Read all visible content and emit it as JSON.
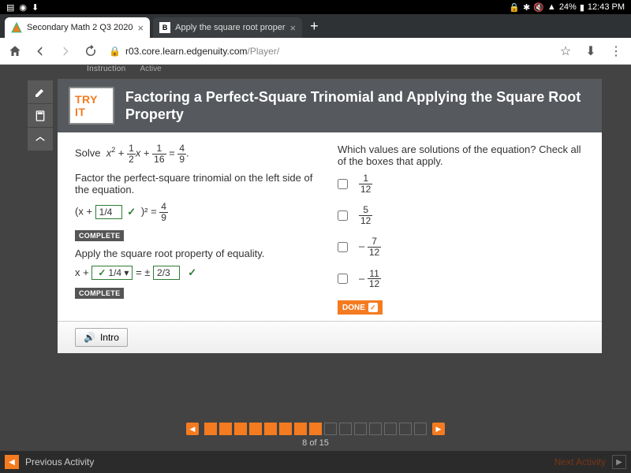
{
  "status": {
    "battery": "24%",
    "time": "12:43 PM"
  },
  "tabs": {
    "active": "Secondary Math 2 Q3 2020",
    "inactive": "Apply the square root proper"
  },
  "url": {
    "host": "r03.core.learn.edgenuity.com",
    "path": "/Player/"
  },
  "topnav": {
    "a": "Instruction",
    "b": "Active"
  },
  "lesson": {
    "badge": "TRY IT",
    "title": "Factoring a Perfect-Square Trinomial and Applying the Square Root Property"
  },
  "left": {
    "solve": "Solve",
    "eq_x2": "x",
    "eq_plus": " + ",
    "eq_eq": " = ",
    "f1n": "1",
    "f1d": "2",
    "f2n": "1",
    "f2d": "16",
    "f3n": "4",
    "f3d": "9",
    "step1": "Factor the perfect-square trinomial on the left side of the equation.",
    "step1_pre": "(x + ",
    "step1_input": "1/4",
    "step1_post": " )² = ",
    "s1n": "4",
    "s1d": "9",
    "complete": "COMPLETE",
    "step2": "Apply the square root property of equality.",
    "step2_pre": "x + ",
    "step2_v1": "1/4 ▾",
    "step2_mid": " = ± ",
    "step2_v2": "2/3"
  },
  "right": {
    "question": "Which values are solutions of the equation? Check all of the boxes that apply.",
    "o1n": "1",
    "o1d": "12",
    "o2n": "5",
    "o2d": "12",
    "o3pre": "–",
    "o3n": "7",
    "o3d": "12",
    "o4pre": "–",
    "o4n": "11",
    "o4d": "12",
    "done": "DONE"
  },
  "intro": "Intro",
  "progress": {
    "text": "8 of 15",
    "current": 8,
    "total": 15
  },
  "footer": {
    "prev": "Previous Activity",
    "next": "Next Activity"
  }
}
